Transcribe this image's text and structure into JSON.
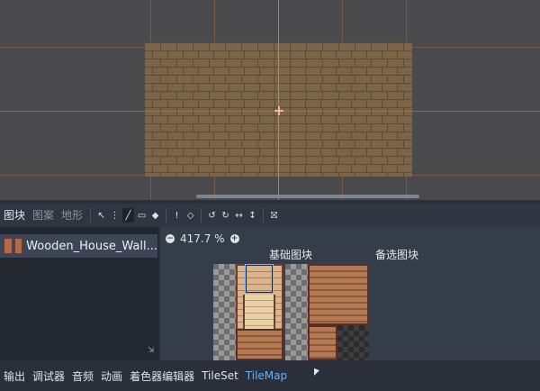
{
  "toolbar": {
    "tabs": [
      {
        "label": "图块",
        "active": true
      },
      {
        "label": "图案",
        "active": false
      },
      {
        "label": "地形",
        "active": false
      }
    ],
    "tools": [
      {
        "icon": "select-arrow-icon",
        "glyph": "↖"
      },
      {
        "icon": "move-icon",
        "glyph": "⋮"
      },
      {
        "icon": "paint-icon",
        "glyph": "╱",
        "pressed": true
      },
      {
        "icon": "rect-icon",
        "glyph": "▭"
      },
      {
        "icon": "bucket-fill-icon",
        "glyph": "◆"
      },
      {
        "icon": "picker-icon",
        "glyph": "!"
      },
      {
        "icon": "eraser-icon",
        "glyph": "◇"
      },
      {
        "icon": "rotate-left-icon",
        "glyph": "↺"
      },
      {
        "icon": "rotate-right-icon",
        "glyph": "↻"
      },
      {
        "icon": "flip-h-icon",
        "glyph": "↔"
      },
      {
        "icon": "flip-v-icon",
        "glyph": "↕"
      },
      {
        "icon": "random-icon",
        "glyph": "⛝"
      }
    ]
  },
  "tile_list": {
    "items": [
      {
        "label": "Wooden_House_Wall..."
      }
    ]
  },
  "atlas": {
    "zoom_text": "417.7 %",
    "basic_label": "基础图块",
    "alt_label": "备选图块"
  },
  "bottom_bar": {
    "items": [
      {
        "label": "输出",
        "active": false
      },
      {
        "label": "调试器",
        "active": false
      },
      {
        "label": "音频",
        "active": false
      },
      {
        "label": "动画",
        "active": false
      },
      {
        "label": "着色器编辑器",
        "active": false
      },
      {
        "label": "TileSet",
        "active": false
      },
      {
        "label": "TileMap",
        "active": true
      }
    ]
  },
  "colors": {
    "accent": "#63b3ff",
    "viewport_bg": "#4a4a4c",
    "panel_bg": "#363d4a"
  }
}
